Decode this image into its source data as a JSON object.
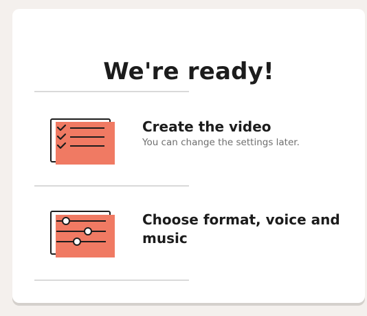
{
  "header": {
    "title": "We're ready!"
  },
  "options": [
    {
      "title": "Create the video",
      "subtitle": "You can change the settings later.",
      "icon": "checklist-icon"
    },
    {
      "title": "Choose format, voice and music",
      "subtitle": "",
      "icon": "sliders-icon"
    }
  ],
  "colors": {
    "accent": "#f07a63",
    "ink": "#1c1c1c",
    "subtext": "#6e6e6e",
    "divider": "#d9d9d9",
    "background": "#f4f0ed"
  }
}
